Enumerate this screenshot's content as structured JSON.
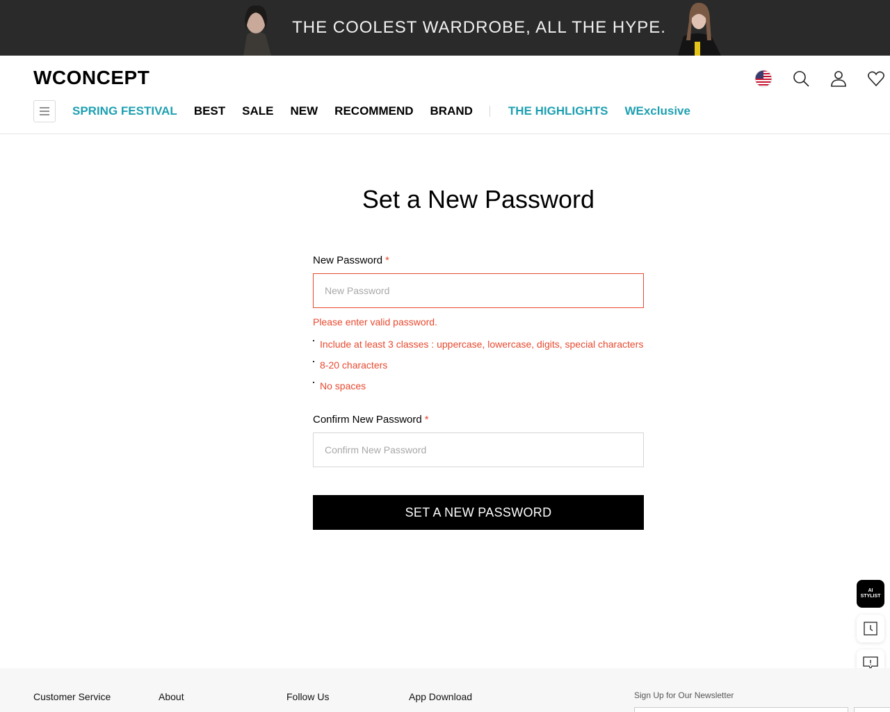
{
  "promo": {
    "text": "THE COOLEST WARDROBE, ALL THE HYPE."
  },
  "header": {
    "logo": "WCONCEPT",
    "nav": [
      {
        "label": "SPRING FESTIVAL",
        "highlight": true
      },
      {
        "label": "BEST",
        "highlight": false
      },
      {
        "label": "SALE",
        "highlight": false
      },
      {
        "label": "NEW",
        "highlight": false
      },
      {
        "label": "RECOMMEND",
        "highlight": false
      },
      {
        "label": "BRAND",
        "highlight": false
      },
      {
        "label": "THE HIGHLIGHTS",
        "highlight": true
      },
      {
        "label": "WExclusive",
        "highlight": true
      }
    ],
    "icons": [
      "us-flag-icon",
      "search-icon",
      "user-icon",
      "heart-icon"
    ]
  },
  "page": {
    "title": "Set a New Password"
  },
  "form": {
    "new_password": {
      "label": "New Password",
      "required_mark": "*",
      "placeholder": "New Password",
      "value": "",
      "error": "Please enter valid password.",
      "rules": [
        "Include at least 3 classes : uppercase, lowercase, digits, special characters",
        "8-20 characters",
        "No spaces"
      ]
    },
    "confirm_password": {
      "label": "Confirm New Password",
      "required_mark": "*",
      "placeholder": "Confirm New Password",
      "value": ""
    },
    "submit_label": "SET A NEW PASSWORD"
  },
  "floating": {
    "ai_line1": "AI",
    "ai_line2": "STYLIST",
    "icons": [
      "recent-clock-icon",
      "chat-icon"
    ]
  },
  "footer": {
    "links": [
      "Customer Service",
      "About",
      "Follow Us",
      "App Download"
    ],
    "newsletter_label": "Sign Up for Our Newsletter"
  },
  "colors": {
    "accent_teal": "#1ea0b1",
    "error_red": "#e8492f",
    "banner_bg": "#2a2a2a"
  }
}
